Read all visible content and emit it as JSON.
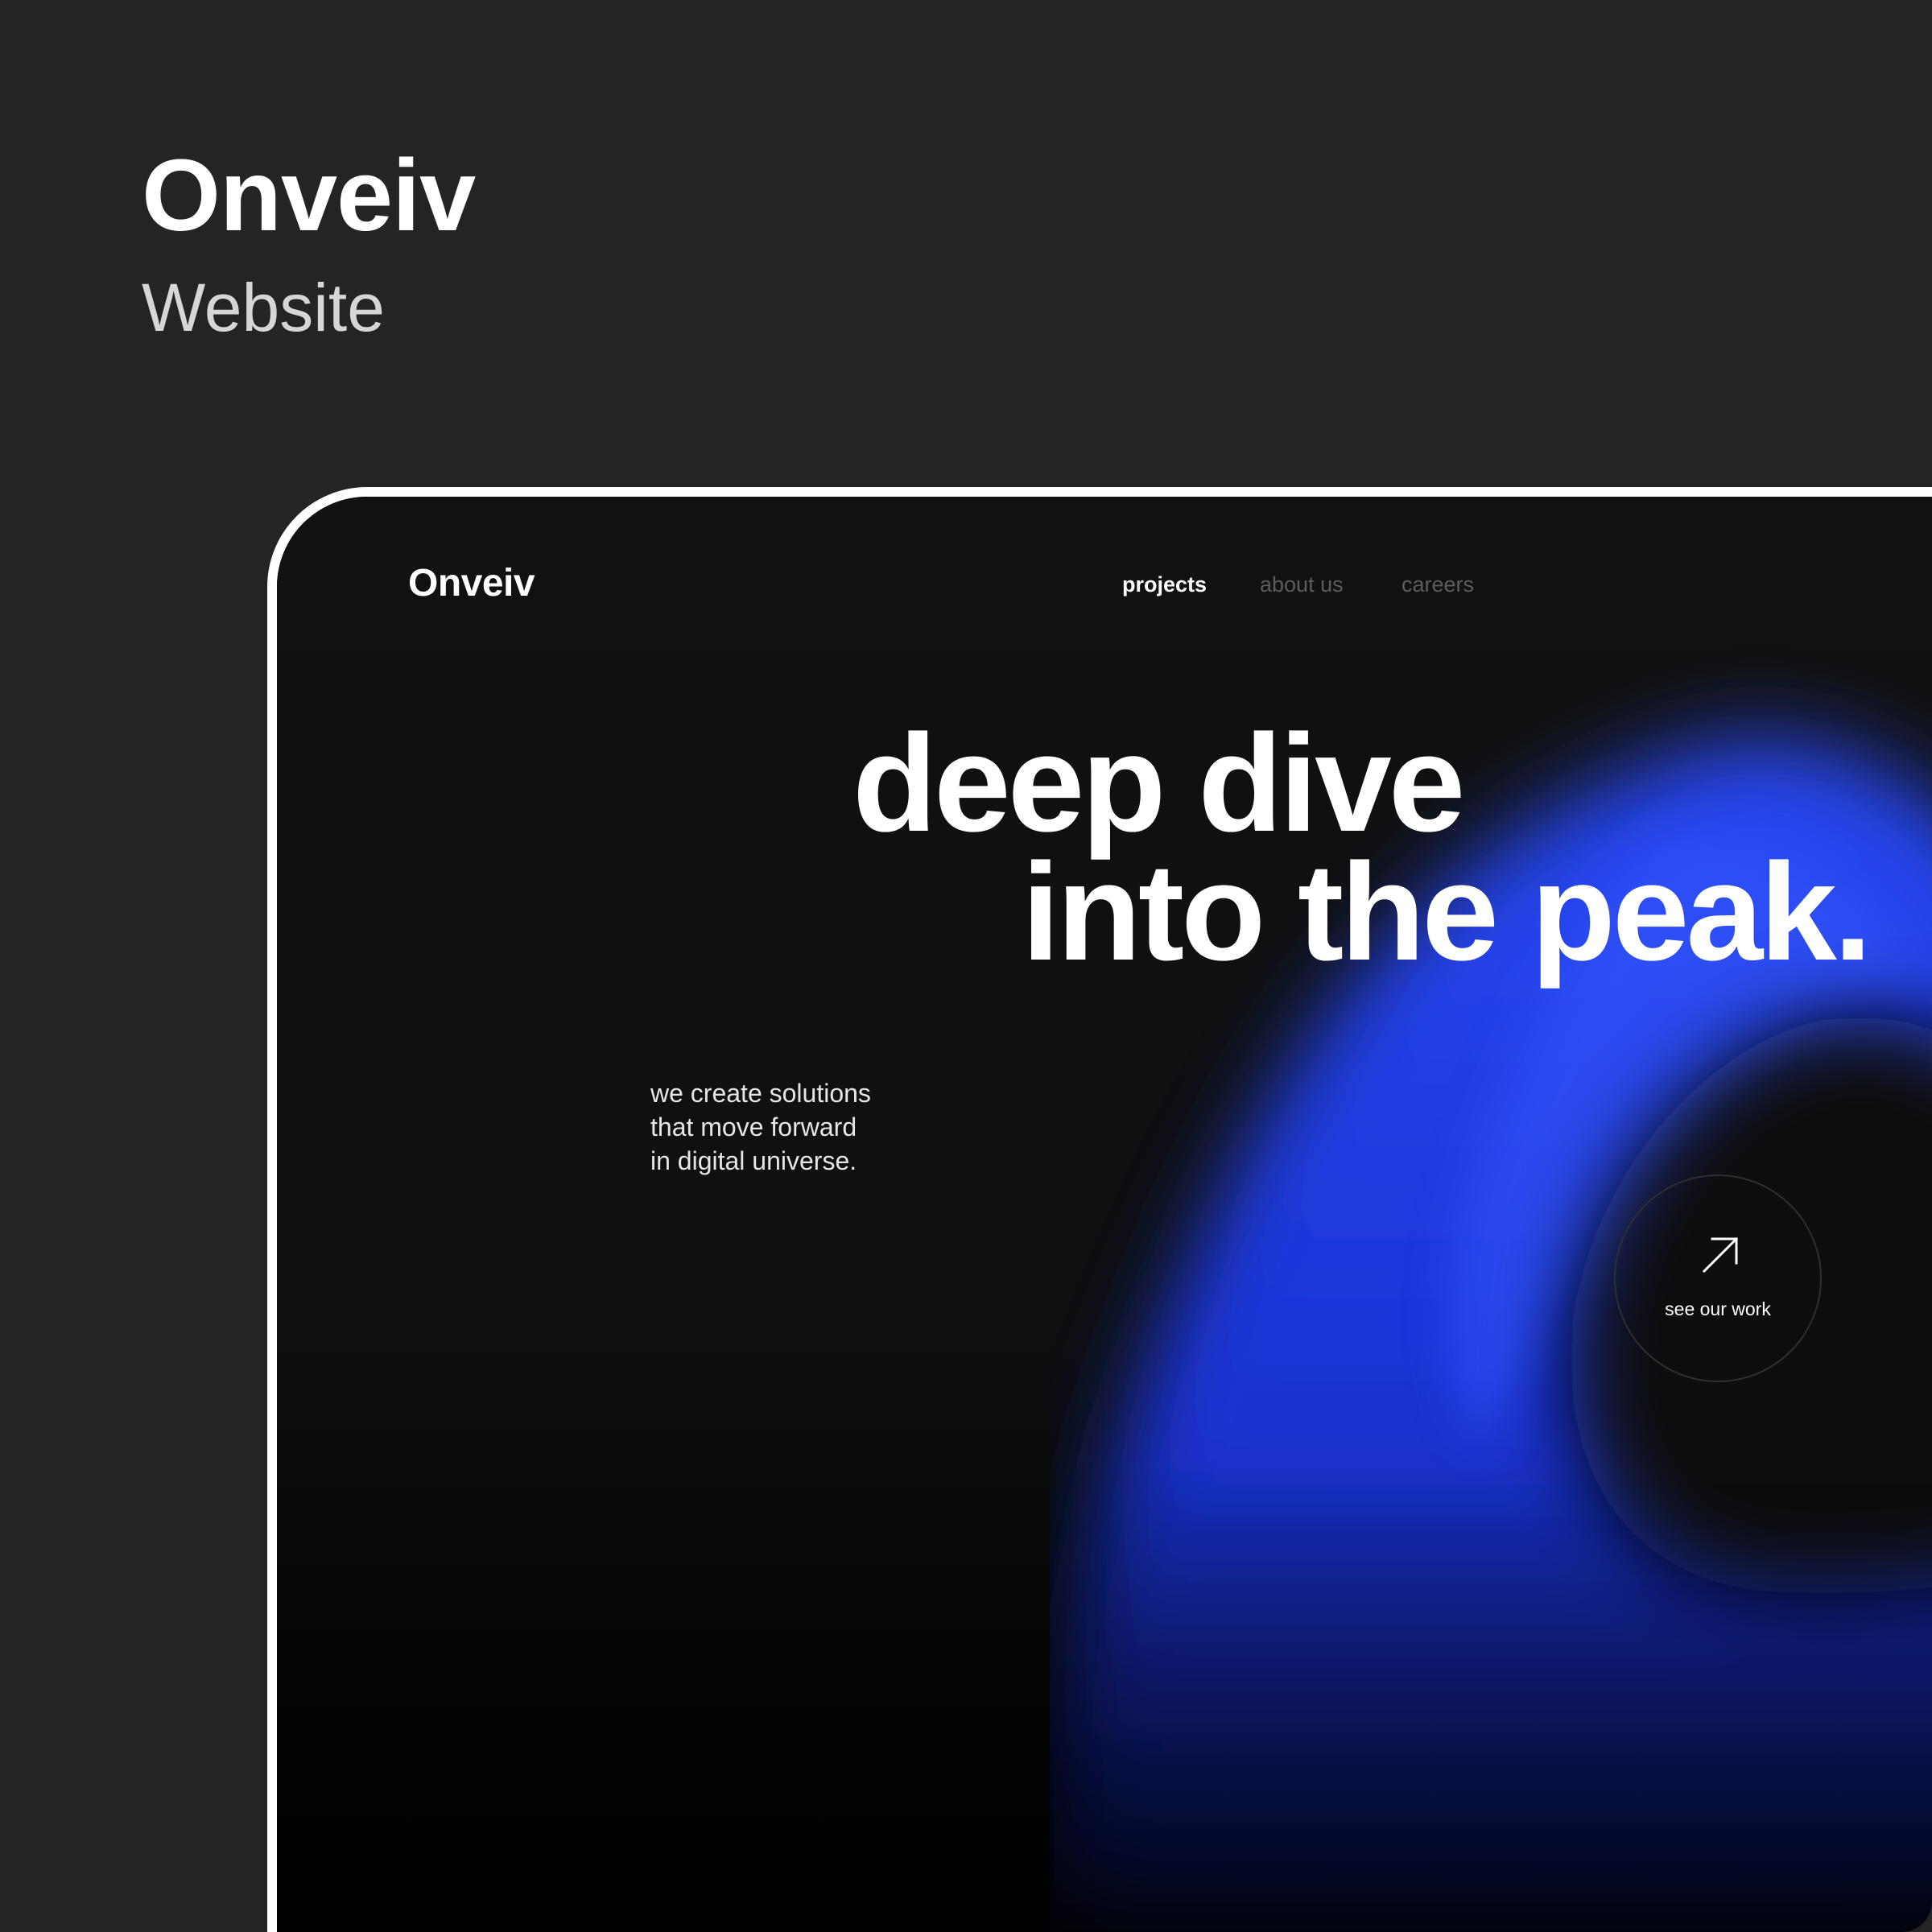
{
  "cover": {
    "title": "Onveiv",
    "subtitle": "Website"
  },
  "site": {
    "logo": "Onveiv",
    "nav": [
      {
        "label": "projects",
        "active": true
      },
      {
        "label": "about us",
        "active": false
      },
      {
        "label": "careers",
        "active": false
      }
    ],
    "hero": {
      "headline_line1": "deep dive",
      "headline_line2": "into the peak.",
      "tagline": [
        "we create solutions",
        "that move forward",
        "in digital universe."
      ]
    },
    "cta": {
      "label": "see our work",
      "icon": "arrow-up-right-icon"
    }
  },
  "colors": {
    "outer_background": "#242424",
    "screen_background": "#101011",
    "device_frame": "#ffffff",
    "accent_blue": "#1f3df0",
    "nav_inactive": "#5c5c5e",
    "text_primary": "#ffffff"
  }
}
